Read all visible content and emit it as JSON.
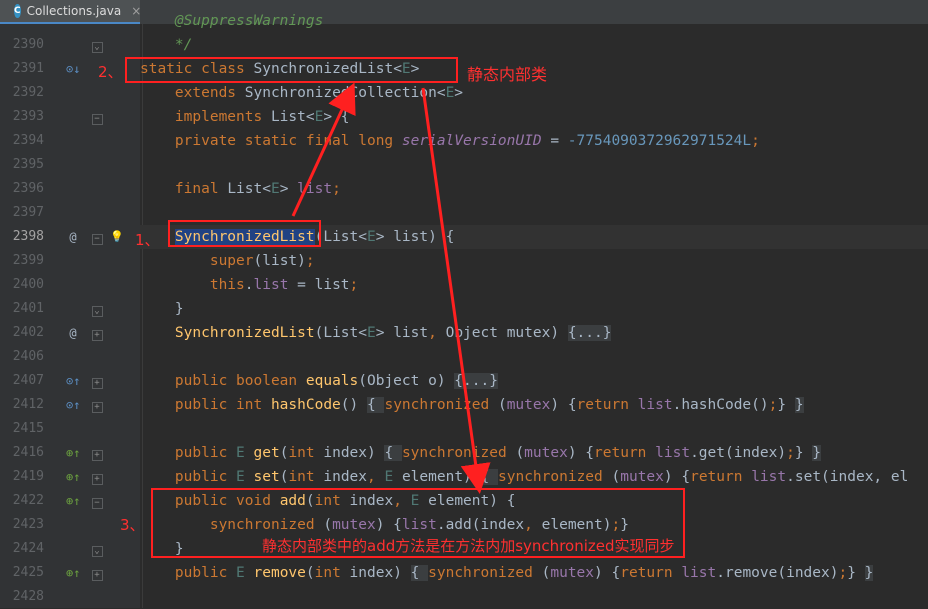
{
  "tab": {
    "file_name": "Collections.java",
    "icon_letter": "C",
    "close_glyph": "×"
  },
  "colors": {
    "keyword": "#cc7832",
    "type": "#a9b7c6",
    "function": "#ffc66d",
    "field": "#9876aa",
    "generic": "#507874",
    "number": "#6897bb",
    "comment": "#629755",
    "plain": "#a9b7c6",
    "fold": "#8c8c8c",
    "annotation": "#ff2020",
    "selection": "#214283"
  },
  "lines": [
    {
      "num": "",
      "fold": "",
      "m1": "",
      "m2": "",
      "tokens": [
        {
          "t": "    @SuppressWarnings",
          "c": "comment"
        }
      ]
    },
    {
      "num": "2390",
      "fold": "end",
      "m1": "",
      "m2": "",
      "tokens": [
        {
          "t": "    */",
          "c": "comment"
        }
      ]
    },
    {
      "num": "2391",
      "fold": "",
      "m1": "overrides-down",
      "m2": "",
      "tokens": [
        {
          "t": "static class ",
          "c": "keyword"
        },
        {
          "t": "SynchronizedList",
          "c": "type"
        },
        {
          "t": "<",
          "c": "plain"
        },
        {
          "t": "E",
          "c": "generic"
        },
        {
          "t": ">",
          "c": "plain"
        }
      ]
    },
    {
      "num": "2392",
      "fold": "",
      "m1": "",
      "m2": "",
      "tokens": [
        {
          "t": "    extends ",
          "c": "keyword"
        },
        {
          "t": "SynchronizedCollection",
          "c": "type"
        },
        {
          "t": "<",
          "c": "plain"
        },
        {
          "t": "E",
          "c": "generic"
        },
        {
          "t": ">",
          "c": "plain"
        }
      ]
    },
    {
      "num": "2393",
      "fold": "start",
      "m1": "",
      "m2": "",
      "tokens": [
        {
          "t": "    implements ",
          "c": "keyword"
        },
        {
          "t": "List",
          "c": "type"
        },
        {
          "t": "<",
          "c": "plain"
        },
        {
          "t": "E",
          "c": "generic"
        },
        {
          "t": "> {",
          "c": "plain"
        }
      ]
    },
    {
      "num": "2394",
      "fold": "",
      "m1": "",
      "m2": "",
      "tokens": [
        {
          "t": "    private static final long ",
          "c": "keyword"
        },
        {
          "t": "serialVersionUID",
          "c": "field_italic"
        },
        {
          "t": " = ",
          "c": "plain"
        },
        {
          "t": "-7754090372962971524L",
          "c": "number"
        },
        {
          "t": ";",
          "c": "keyword"
        }
      ]
    },
    {
      "num": "2395",
      "fold": "",
      "m1": "",
      "m2": "",
      "tokens": []
    },
    {
      "num": "2396",
      "fold": "",
      "m1": "",
      "m2": "",
      "tokens": [
        {
          "t": "    final ",
          "c": "keyword"
        },
        {
          "t": "List",
          "c": "type"
        },
        {
          "t": "<",
          "c": "plain"
        },
        {
          "t": "E",
          "c": "generic"
        },
        {
          "t": "> ",
          "c": "plain"
        },
        {
          "t": "list",
          "c": "field"
        },
        {
          "t": ";",
          "c": "keyword"
        }
      ]
    },
    {
      "num": "2397",
      "fold": "",
      "m1": "",
      "m2": "",
      "tokens": []
    },
    {
      "num": "2398",
      "fold": "start",
      "m1": "at",
      "m2": "bulb",
      "hl": true,
      "tokens": [
        {
          "t": "    ",
          "c": "plain"
        },
        {
          "t": "SynchronizedList",
          "c": "selected"
        },
        {
          "t": "(List<",
          "c": "plain"
        },
        {
          "t": "E",
          "c": "generic"
        },
        {
          "t": "> list) {",
          "c": "plain"
        }
      ]
    },
    {
      "num": "2399",
      "fold": "",
      "m1": "",
      "m2": "",
      "tokens": [
        {
          "t": "        super",
          "c": "keyword"
        },
        {
          "t": "(list)",
          "c": "plain"
        },
        {
          "t": ";",
          "c": "keyword"
        }
      ]
    },
    {
      "num": "2400",
      "fold": "",
      "m1": "",
      "m2": "",
      "tokens": [
        {
          "t": "        this",
          "c": "keyword"
        },
        {
          "t": ".",
          "c": "plain"
        },
        {
          "t": "list",
          "c": "field"
        },
        {
          "t": " = list",
          "c": "plain"
        },
        {
          "t": ";",
          "c": "keyword"
        }
      ]
    },
    {
      "num": "2401",
      "fold": "end",
      "m1": "",
      "m2": "",
      "tokens": [
        {
          "t": "    }",
          "c": "plain"
        }
      ]
    },
    {
      "num": "2402",
      "fold": "plus",
      "m1": "at",
      "m2": "",
      "tokens": [
        {
          "t": "    ",
          "c": "plain"
        },
        {
          "t": "SynchronizedList",
          "c": "function"
        },
        {
          "t": "(List<",
          "c": "plain"
        },
        {
          "t": "E",
          "c": "generic"
        },
        {
          "t": "> list",
          "c": "plain"
        },
        {
          "t": ", ",
          "c": "keyword"
        },
        {
          "t": "Object mutex) ",
          "c": "plain"
        },
        {
          "t": "{...}",
          "c": "folded"
        }
      ]
    },
    {
      "num": "2406",
      "fold": "",
      "m1": "",
      "m2": "",
      "tokens": []
    },
    {
      "num": "2407",
      "fold": "plus",
      "m1": "overrides-up",
      "m2": "",
      "tokens": [
        {
          "t": "    public boolean ",
          "c": "keyword"
        },
        {
          "t": "equals",
          "c": "function"
        },
        {
          "t": "(Object o) ",
          "c": "plain"
        },
        {
          "t": "{...}",
          "c": "folded"
        }
      ]
    },
    {
      "num": "2412",
      "fold": "plus",
      "m1": "overrides-up",
      "m2": "",
      "tokens": [
        {
          "t": "    public int ",
          "c": "keyword"
        },
        {
          "t": "hashCode",
          "c": "function"
        },
        {
          "t": "() ",
          "c": "plain"
        },
        {
          "t": "{ ",
          "c": "folded"
        },
        {
          "t": "synchronized ",
          "c": "keyword"
        },
        {
          "t": "(",
          "c": "plain"
        },
        {
          "t": "mutex",
          "c": "field"
        },
        {
          "t": ") {",
          "c": "plain"
        },
        {
          "t": "return ",
          "c": "keyword"
        },
        {
          "t": "list",
          "c": "field"
        },
        {
          "t": ".hashCode()",
          "c": "plain"
        },
        {
          "t": ";",
          "c": "keyword"
        },
        {
          "t": "} ",
          "c": "plain"
        },
        {
          "t": "}",
          "c": "folded"
        }
      ]
    },
    {
      "num": "2415",
      "fold": "",
      "m1": "",
      "m2": "",
      "tokens": []
    },
    {
      "num": "2416",
      "fold": "plus",
      "m1": "implements-up",
      "m2": "",
      "tokens": [
        {
          "t": "    public ",
          "c": "keyword"
        },
        {
          "t": "E ",
          "c": "generic"
        },
        {
          "t": "get",
          "c": "function"
        },
        {
          "t": "(",
          "c": "plain"
        },
        {
          "t": "int ",
          "c": "keyword"
        },
        {
          "t": "index) ",
          "c": "plain"
        },
        {
          "t": "{ ",
          "c": "folded"
        },
        {
          "t": "synchronized ",
          "c": "keyword"
        },
        {
          "t": "(",
          "c": "plain"
        },
        {
          "t": "mutex",
          "c": "field"
        },
        {
          "t": ") {",
          "c": "plain"
        },
        {
          "t": "return ",
          "c": "keyword"
        },
        {
          "t": "list",
          "c": "field"
        },
        {
          "t": ".get(index)",
          "c": "plain"
        },
        {
          "t": ";",
          "c": "keyword"
        },
        {
          "t": "} ",
          "c": "plain"
        },
        {
          "t": "}",
          "c": "folded"
        }
      ]
    },
    {
      "num": "2419",
      "fold": "plus",
      "m1": "implements-up",
      "m2": "",
      "tokens": [
        {
          "t": "    public ",
          "c": "keyword"
        },
        {
          "t": "E ",
          "c": "generic"
        },
        {
          "t": "set",
          "c": "function"
        },
        {
          "t": "(",
          "c": "plain"
        },
        {
          "t": "int ",
          "c": "keyword"
        },
        {
          "t": "index",
          "c": "plain"
        },
        {
          "t": ", ",
          "c": "keyword"
        },
        {
          "t": "E ",
          "c": "generic"
        },
        {
          "t": "element) ",
          "c": "plain"
        },
        {
          "t": "{ ",
          "c": "folded"
        },
        {
          "t": "synchronized ",
          "c": "keyword"
        },
        {
          "t": "(",
          "c": "plain"
        },
        {
          "t": "mutex",
          "c": "field"
        },
        {
          "t": ") {",
          "c": "plain"
        },
        {
          "t": "return ",
          "c": "keyword"
        },
        {
          "t": "list",
          "c": "field"
        },
        {
          "t": ".set(index, el",
          "c": "plain"
        }
      ]
    },
    {
      "num": "2422",
      "fold": "start",
      "m1": "implements-up",
      "m2": "",
      "tokens": [
        {
          "t": "    public void ",
          "c": "keyword"
        },
        {
          "t": "add",
          "c": "function"
        },
        {
          "t": "(",
          "c": "plain"
        },
        {
          "t": "int ",
          "c": "keyword"
        },
        {
          "t": "index",
          "c": "plain"
        },
        {
          "t": ", ",
          "c": "keyword"
        },
        {
          "t": "E ",
          "c": "generic"
        },
        {
          "t": "element) {",
          "c": "plain"
        }
      ]
    },
    {
      "num": "2423",
      "fold": "",
      "m1": "",
      "m2": "",
      "tokens": [
        {
          "t": "        synchronized ",
          "c": "keyword"
        },
        {
          "t": "(",
          "c": "plain"
        },
        {
          "t": "mutex",
          "c": "field"
        },
        {
          "t": ") {",
          "c": "plain"
        },
        {
          "t": "list",
          "c": "field"
        },
        {
          "t": ".add(index",
          "c": "plain"
        },
        {
          "t": ", ",
          "c": "keyword"
        },
        {
          "t": "element)",
          "c": "plain"
        },
        {
          "t": ";",
          "c": "keyword"
        },
        {
          "t": "}",
          "c": "plain"
        }
      ]
    },
    {
      "num": "2424",
      "fold": "end",
      "m1": "",
      "m2": "",
      "tokens": [
        {
          "t": "    }",
          "c": "plain"
        }
      ]
    },
    {
      "num": "2425",
      "fold": "plus",
      "m1": "implements-up",
      "m2": "",
      "tokens": [
        {
          "t": "    public ",
          "c": "keyword"
        },
        {
          "t": "E ",
          "c": "generic"
        },
        {
          "t": "remove",
          "c": "function"
        },
        {
          "t": "(",
          "c": "plain"
        },
        {
          "t": "int ",
          "c": "keyword"
        },
        {
          "t": "index) ",
          "c": "plain"
        },
        {
          "t": "{ ",
          "c": "folded"
        },
        {
          "t": "synchronized ",
          "c": "keyword"
        },
        {
          "t": "(",
          "c": "plain"
        },
        {
          "t": "mutex",
          "c": "field"
        },
        {
          "t": ") {",
          "c": "plain"
        },
        {
          "t": "return ",
          "c": "keyword"
        },
        {
          "t": "list",
          "c": "field"
        },
        {
          "t": ".remove(index)",
          "c": "plain"
        },
        {
          "t": ";",
          "c": "keyword"
        },
        {
          "t": "} ",
          "c": "plain"
        },
        {
          "t": "}",
          "c": "folded"
        }
      ]
    },
    {
      "num": "2428",
      "fold": "",
      "m1": "",
      "m2": "",
      "tokens": []
    }
  ],
  "markers": {
    "at": "@",
    "bulb": "💡",
    "overrides-down": "⊙↓",
    "overrides-up": "⊙↑",
    "implements-up": "⊕↑",
    "fold-plus": "+",
    "fold-start": "−",
    "fold-end": "⌄"
  },
  "annotations": {
    "label_1": "1、",
    "label_2": "2、",
    "label_3": "3、",
    "note_static": "静态内部类",
    "note_add": "静态内部类中的add方法是在方法内加synchronized实现同步"
  }
}
